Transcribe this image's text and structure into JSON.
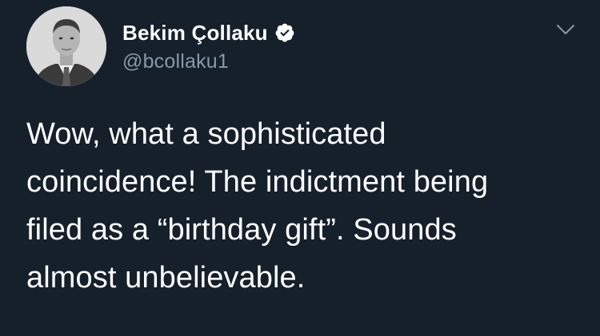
{
  "author": {
    "display_name": "Bekim Çollaku",
    "handle": "@bcollaku1",
    "verified": true
  },
  "tweet": {
    "lines": [
      "Wow, what a sophisticated",
      "coincidence! The indictment being",
      "filed as a “birthday gift”. Sounds",
      "almost unbelievable."
    ]
  },
  "icons": {
    "verified": "verified-badge-icon",
    "menu": "chevron-down-icon"
  },
  "colors": {
    "background": "#15202b",
    "text_primary": "#ffffff",
    "text_secondary": "#8899a6"
  }
}
